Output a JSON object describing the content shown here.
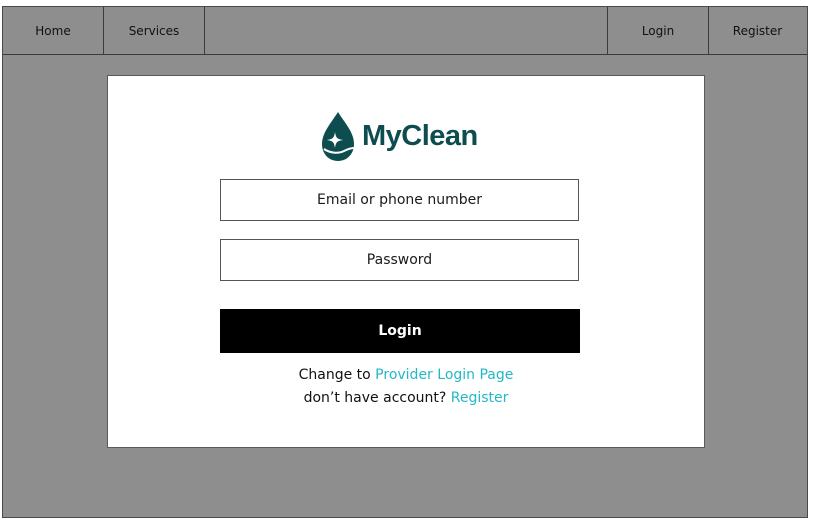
{
  "nav": {
    "home": "Home",
    "services": "Services",
    "login": "Login",
    "register": "Register"
  },
  "brand": {
    "name": "MyClean",
    "logo_icon": "water-drop-sparkle-icon",
    "color": "#0e4d4f"
  },
  "form": {
    "email_placeholder": "Email or phone number",
    "password_placeholder": "Password",
    "login_button": "Login"
  },
  "footer_links": {
    "provider_prefix": "Change to ",
    "provider_link": "Provider Login Page",
    "register_prefix": "don’t have account? ",
    "register_link": "Register",
    "link_color": "#22b8c8"
  },
  "colors": {
    "background": "#8e8e8e",
    "card": "#ffffff",
    "button": "#000000"
  }
}
